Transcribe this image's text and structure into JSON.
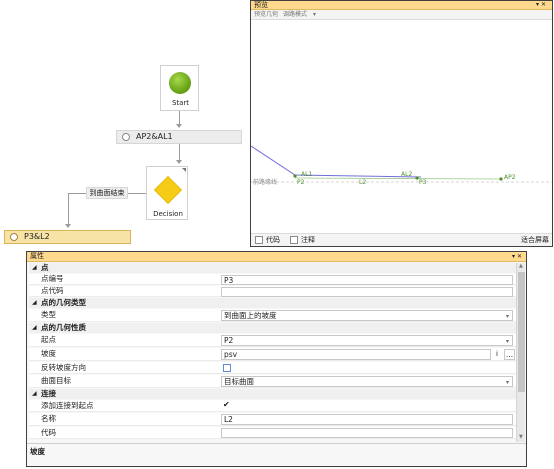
{
  "flow": {
    "start_label": "Start",
    "step1_label": "AP2&AL1",
    "decision_label": "Decision",
    "edge_label": "到曲面结束",
    "selected_label": "P3&L2"
  },
  "preview": {
    "title": "预览",
    "title_buttons": "▾ ✕",
    "tab1": "预览几何",
    "tab2": "调路模式",
    "tab_dropdown": "▾",
    "labels": {
      "left_axis": "前路缘线",
      "al1": "AL1",
      "p2": "P2",
      "l2": "L2",
      "al2": "AL2",
      "p3": "P3",
      "ap2": "AP2"
    },
    "status": {
      "code_label": "代码",
      "comment_label": "注释",
      "fit_button": "适合屏幕"
    }
  },
  "properties": {
    "title": "属性",
    "title_buttons": "▾ ✕",
    "sections": [
      {
        "name": "点"
      },
      {
        "name": "点的几何类型"
      },
      {
        "name": "点的几何性质"
      },
      {
        "name": "连接"
      }
    ],
    "rows": {
      "point_number": {
        "label": "点编号",
        "value": "P3"
      },
      "point_code": {
        "label": "点代码",
        "value": ""
      },
      "type": {
        "label": "类型",
        "value": "到曲面上的坡度"
      },
      "from_point": {
        "label": "起点",
        "value": "P2"
      },
      "slope": {
        "label": "坡度",
        "value": "psv",
        "info": "i",
        "more": "..."
      },
      "reverse_slope": {
        "label": "反转坡度方向"
      },
      "surface_target": {
        "label": "曲面目标",
        "value": "目标曲面"
      },
      "add_link": {
        "label": "添加连接到起点",
        "checked": "✔"
      },
      "name": {
        "label": "名称",
        "value": "L2"
      },
      "code": {
        "label": "代码",
        "value": ""
      }
    },
    "description_title": "坡度"
  }
}
